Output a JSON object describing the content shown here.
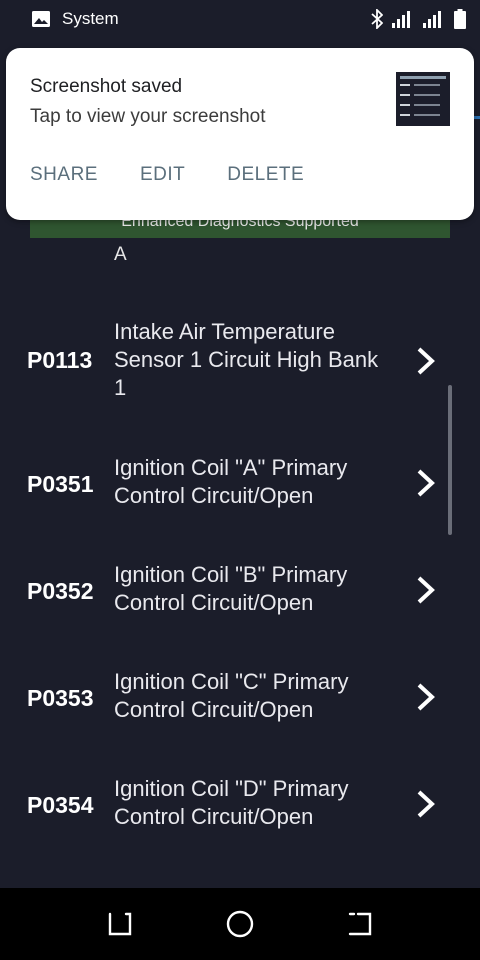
{
  "status_bar": {
    "app_label": "System",
    "left_icon": "image-icon",
    "right_icons": [
      "bluetooth-icon",
      "signal-icon",
      "signal-icon",
      "battery-icon"
    ]
  },
  "notification": {
    "title": "Screenshot saved",
    "text": "Tap to view your screenshot",
    "actions": [
      "SHARE",
      "EDIT",
      "DELETE"
    ]
  },
  "banner": "Enhanced Diagnostics Supported",
  "partial_text": "A",
  "codes": [
    {
      "code": "P0113",
      "description": "Intake Air Temperature Sensor 1 Circuit High Bank 1"
    },
    {
      "code": "P0351",
      "description": "Ignition Coil \"A\" Primary Control Circuit/Open"
    },
    {
      "code": "P0352",
      "description": "Ignition Coil \"B\" Primary Control Circuit/Open"
    },
    {
      "code": "P0353",
      "description": "Ignition Coil \"C\" Primary Control Circuit/Open"
    },
    {
      "code": "P0354",
      "description": "Ignition Coil \"D\" Primary Control Circuit/Open"
    }
  ],
  "nav": [
    "recents-icon",
    "home-icon",
    "back-icon"
  ],
  "colors": {
    "background": "#1b1d2a",
    "banner": "#2f5530",
    "action_text": "#5b6f7c"
  }
}
